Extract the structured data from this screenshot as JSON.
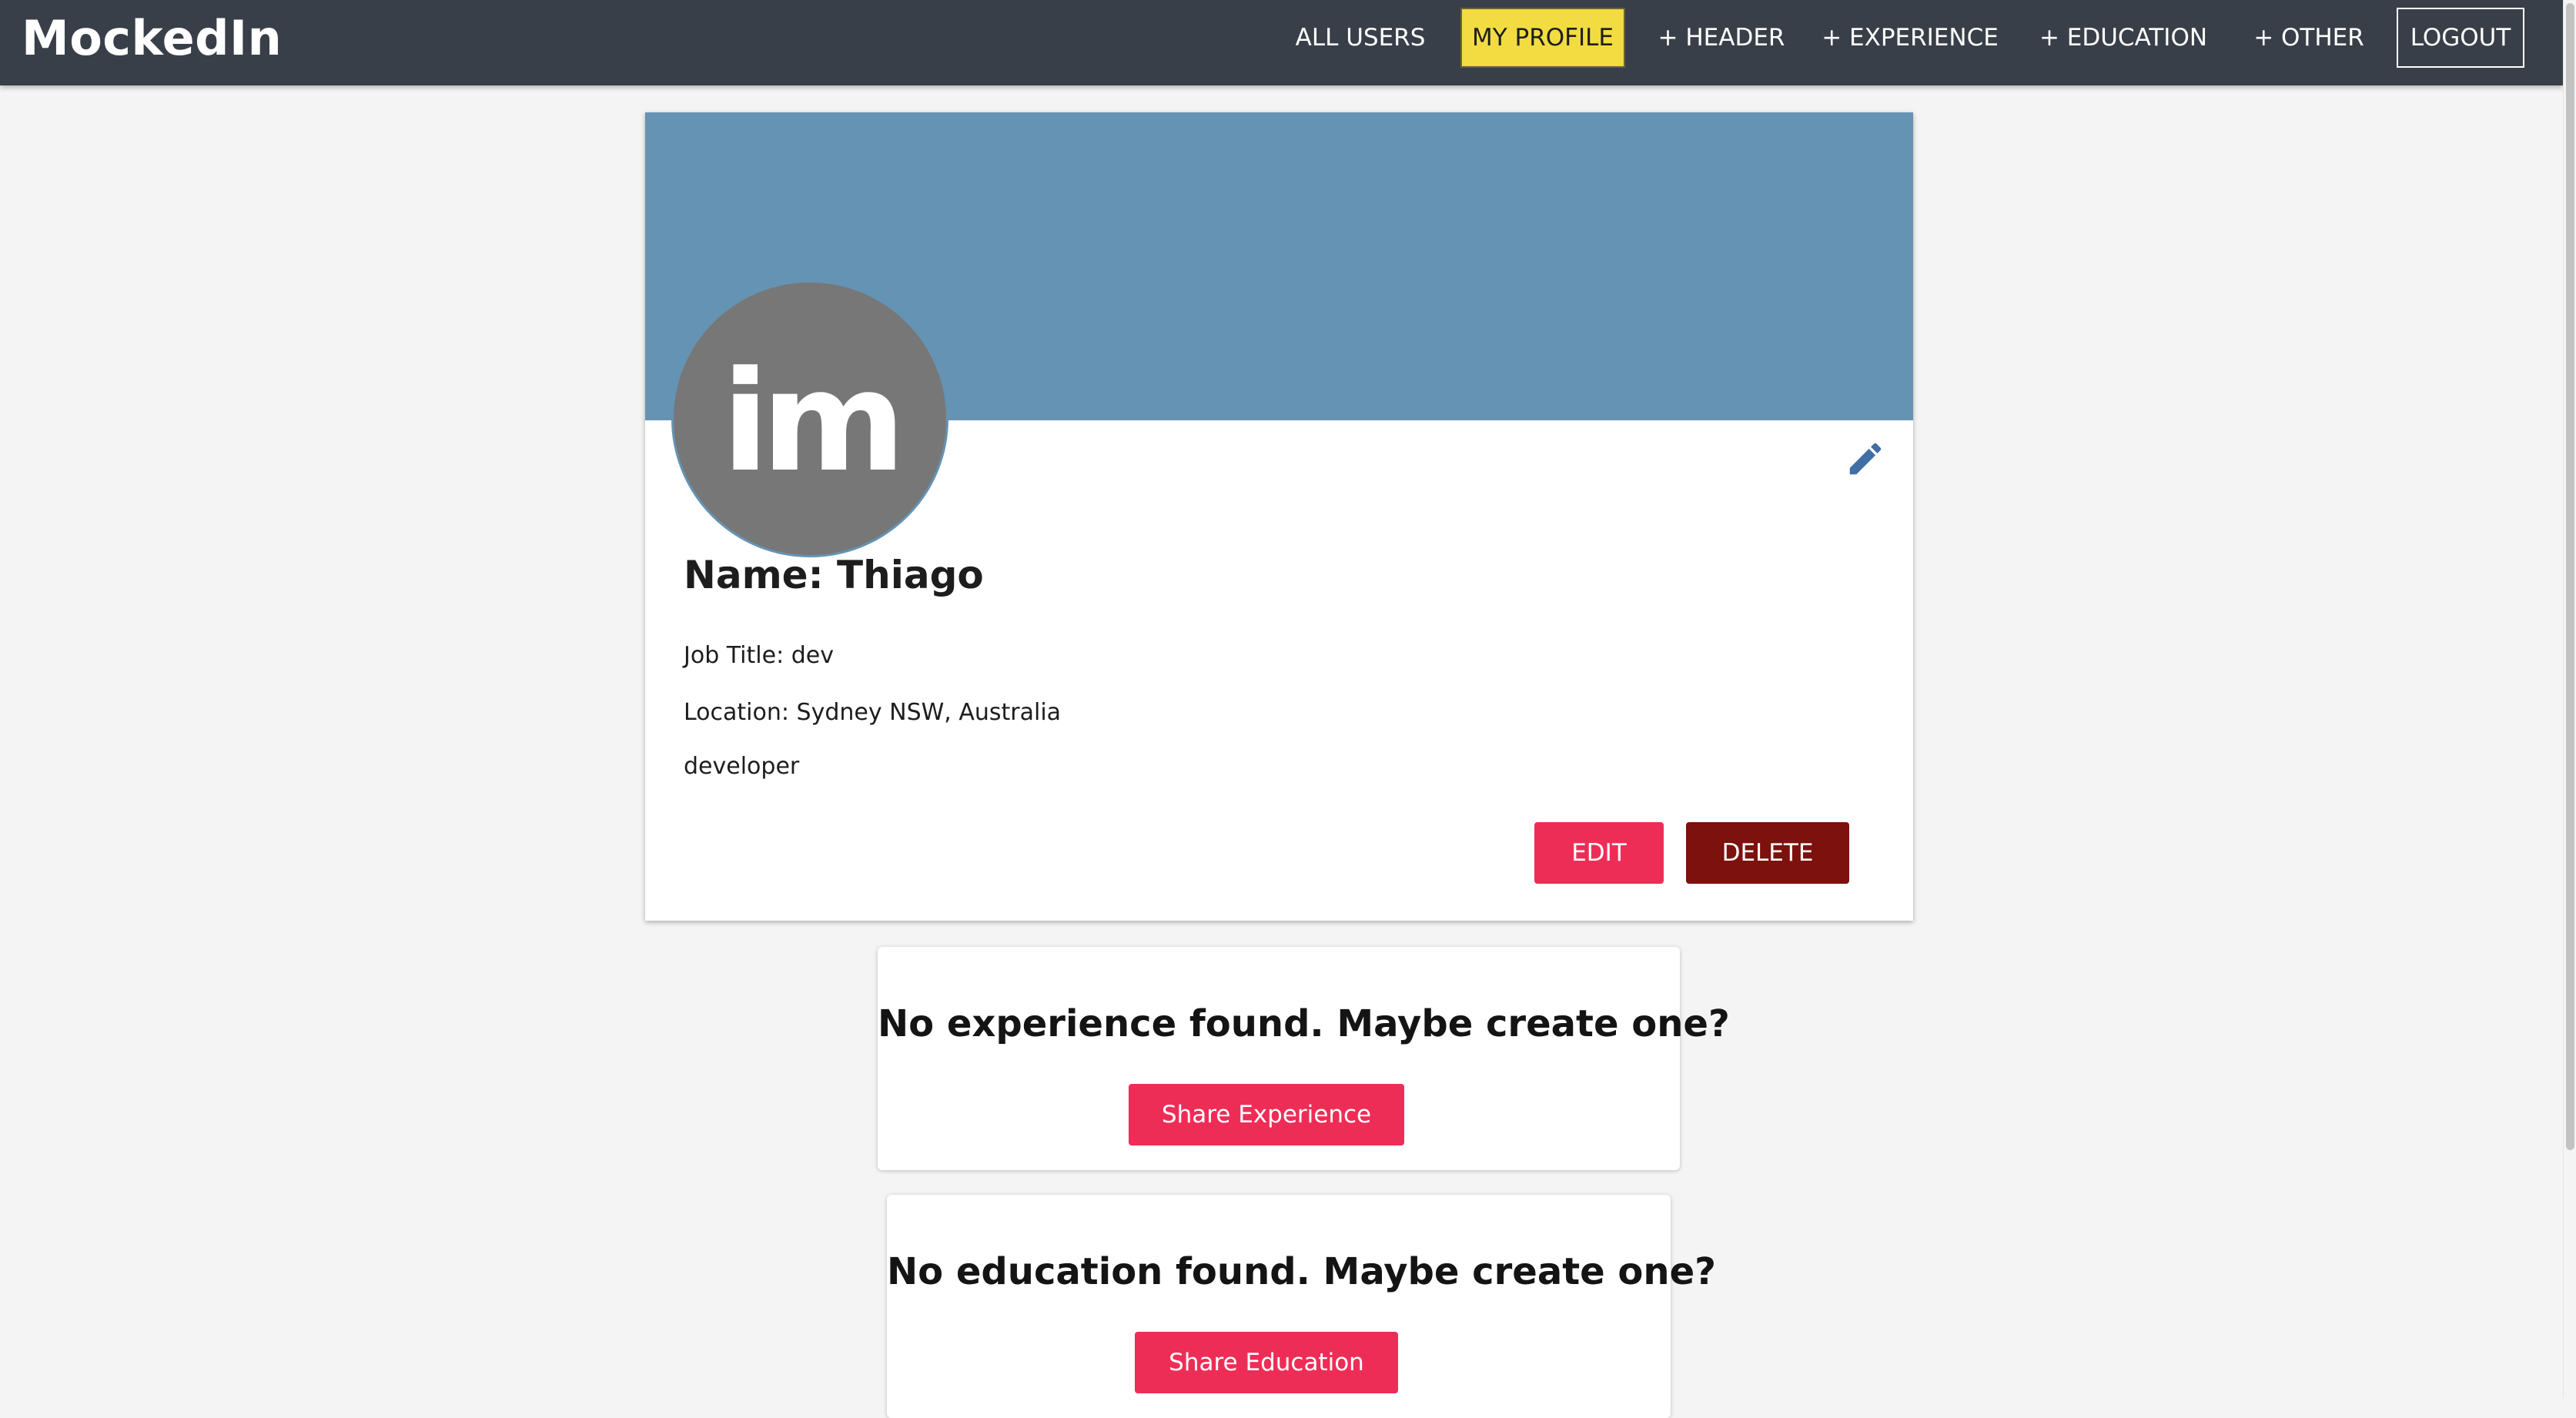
{
  "app": {
    "brand": "MockedIn"
  },
  "nav": {
    "all_users": "ALL USERS",
    "my_profile": "MY PROFILE",
    "add_header": "+ HEADER",
    "add_experience": "+ EXPERIENCE",
    "add_education": "+ EDUCATION",
    "add_other": "+ OTHER",
    "logout": "LOGOUT"
  },
  "profile": {
    "avatar_initials": "im",
    "name": "Name: Thiago",
    "job_title": "Job Title: dev",
    "location": "Location: Sydney NSW, Australia",
    "description": "developer",
    "edit_label": "EDIT",
    "delete_label": "DELETE",
    "banner_color": "#6593b3",
    "avatar_color": "#777777"
  },
  "experience": {
    "empty_message": "No experience found. Maybe create one?",
    "button_label": "Share Experience"
  },
  "education": {
    "empty_message": "No education found. Maybe create one?",
    "button_label": "Share Education"
  },
  "colors": {
    "navbar": "#393f48",
    "active_nav": "#f2dc41",
    "accent_pink": "#ee2d57",
    "accent_maroon": "#7c110d",
    "pencil": "#3f6fa6"
  },
  "icons": {
    "edit": "pencil-icon"
  }
}
